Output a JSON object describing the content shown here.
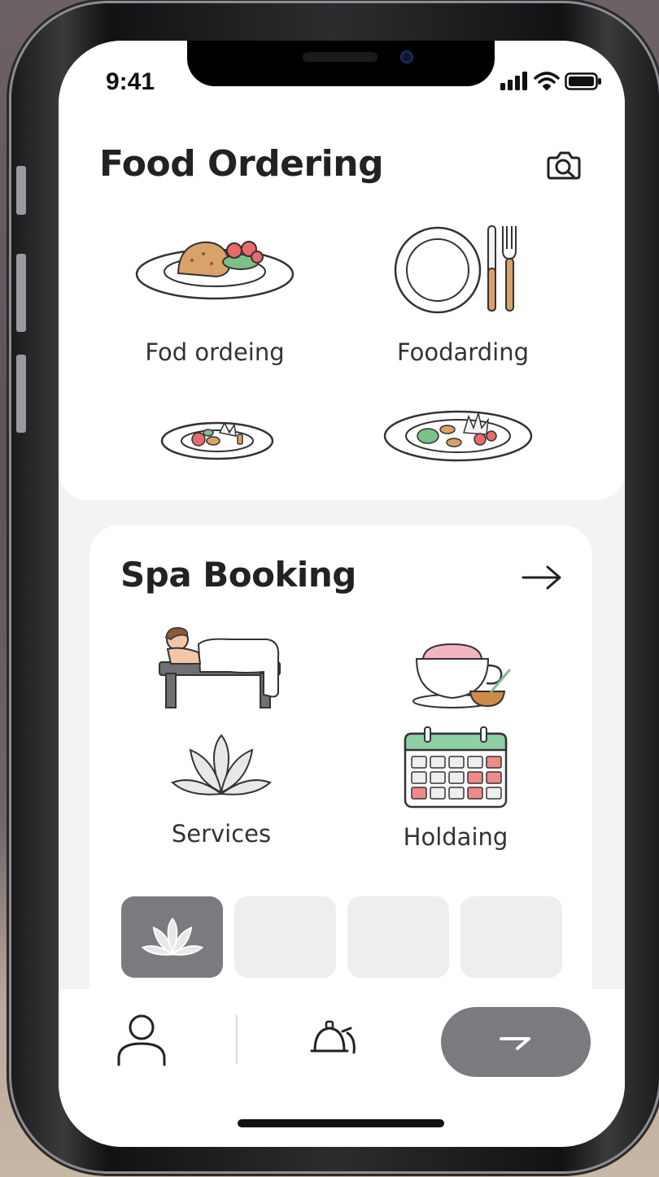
{
  "status_bar": {
    "time": "9:41",
    "icons": [
      "signal-icon",
      "wifi-icon",
      "battery-icon"
    ]
  },
  "food_section": {
    "title": "Food Ordering",
    "action_icon": "camera-search-icon",
    "items": [
      {
        "label": "Fod ordeing",
        "icon": "plated-meal-icon"
      },
      {
        "label": "Foodarding",
        "icon": "plate-cutlery-icon"
      },
      {
        "label": "",
        "icon": "small-salad-plate-icon"
      },
      {
        "label": "",
        "icon": "garnished-plate-icon"
      }
    ]
  },
  "spa_section": {
    "title": "Spa Booking",
    "action_icon": "arrow-right-icon",
    "items": [
      {
        "label": "",
        "icon": "massage-table-icon"
      },
      {
        "label": "",
        "icon": "latte-cup-icon"
      },
      {
        "label": "Services",
        "icon": "lotus-icon"
      },
      {
        "label": "Holdaing",
        "icon": "calendar-icon"
      }
    ],
    "thumbnails": [
      {
        "icon": "lotus-icon",
        "selected": true
      },
      {
        "icon": "",
        "selected": false
      },
      {
        "icon": "",
        "selected": false
      },
      {
        "icon": "",
        "selected": false
      }
    ]
  },
  "bottom_nav": {
    "items": [
      "profile-icon",
      "bell-service-icon"
    ],
    "fab_icon": "arrow-right-icon"
  },
  "colors": {
    "fab": "#7b7a80",
    "thumb_selected": "#7b7a80",
    "thumb_default": "#eeeeef",
    "calendar_header": "#8fd0a6",
    "calendar_accent": "#f08a8a"
  }
}
